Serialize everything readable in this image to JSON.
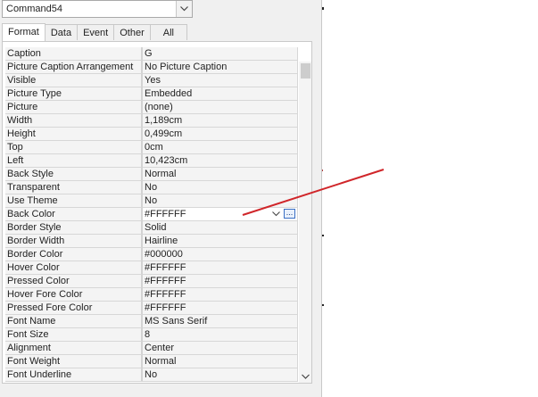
{
  "object_selector": {
    "value": "Command54"
  },
  "tabs": [
    "Format",
    "Data",
    "Event",
    "Other",
    "All"
  ],
  "active_tab": "Format",
  "properties": [
    {
      "name": "Caption",
      "value": "G"
    },
    {
      "name": "Picture Caption Arrangement",
      "value": "No Picture Caption"
    },
    {
      "name": "Visible",
      "value": "Yes"
    },
    {
      "name": "Picture Type",
      "value": "Embedded"
    },
    {
      "name": "Picture",
      "value": "(none)"
    },
    {
      "name": "Width",
      "value": "1,189cm"
    },
    {
      "name": "Height",
      "value": "0,499cm"
    },
    {
      "name": "Top",
      "value": "0cm"
    },
    {
      "name": "Left",
      "value": "10,423cm"
    },
    {
      "name": "Back Style",
      "value": "Normal"
    },
    {
      "name": "Transparent",
      "value": "No"
    },
    {
      "name": "Use Theme",
      "value": "No"
    },
    {
      "name": "Back Color",
      "value": "#FFFFFF",
      "selected": true
    },
    {
      "name": "Border Style",
      "value": "Solid"
    },
    {
      "name": "Border Width",
      "value": "Hairline"
    },
    {
      "name": "Border Color",
      "value": "#000000"
    },
    {
      "name": "Hover Color",
      "value": "#FFFFFF"
    },
    {
      "name": "Pressed Color",
      "value": "#FFFFFF"
    },
    {
      "name": "Hover Fore Color",
      "value": "#FFFFFF"
    },
    {
      "name": "Pressed Fore Color",
      "value": "#FFFFFF"
    },
    {
      "name": "Font Name",
      "value": "MS Sans Serif"
    },
    {
      "name": "Font Size",
      "value": "8"
    },
    {
      "name": "Alignment",
      "value": "Center"
    },
    {
      "name": "Font Weight",
      "value": "Normal"
    },
    {
      "name": "Font Underline",
      "value": "No"
    }
  ],
  "builder_button": {
    "label": "..."
  },
  "colors": {
    "annotation_arrow": "#d0262a",
    "selected_button_border": "#3a6fc4"
  }
}
